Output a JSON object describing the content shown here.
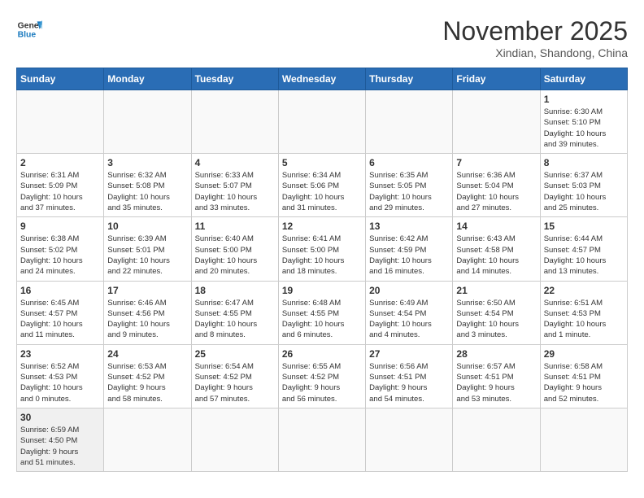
{
  "logo": {
    "text_general": "General",
    "text_blue": "Blue"
  },
  "title": "November 2025",
  "subtitle": "Xindian, Shandong, China",
  "weekdays": [
    "Sunday",
    "Monday",
    "Tuesday",
    "Wednesday",
    "Thursday",
    "Friday",
    "Saturday"
  ],
  "days": [
    {
      "date": null,
      "info": ""
    },
    {
      "date": null,
      "info": ""
    },
    {
      "date": null,
      "info": ""
    },
    {
      "date": null,
      "info": ""
    },
    {
      "date": null,
      "info": ""
    },
    {
      "date": null,
      "info": ""
    },
    {
      "date": "1",
      "info": "Sunrise: 6:30 AM\nSunset: 5:10 PM\nDaylight: 10 hours\nand 39 minutes."
    },
    {
      "date": "2",
      "info": "Sunrise: 6:31 AM\nSunset: 5:09 PM\nDaylight: 10 hours\nand 37 minutes."
    },
    {
      "date": "3",
      "info": "Sunrise: 6:32 AM\nSunset: 5:08 PM\nDaylight: 10 hours\nand 35 minutes."
    },
    {
      "date": "4",
      "info": "Sunrise: 6:33 AM\nSunset: 5:07 PM\nDaylight: 10 hours\nand 33 minutes."
    },
    {
      "date": "5",
      "info": "Sunrise: 6:34 AM\nSunset: 5:06 PM\nDaylight: 10 hours\nand 31 minutes."
    },
    {
      "date": "6",
      "info": "Sunrise: 6:35 AM\nSunset: 5:05 PM\nDaylight: 10 hours\nand 29 minutes."
    },
    {
      "date": "7",
      "info": "Sunrise: 6:36 AM\nSunset: 5:04 PM\nDaylight: 10 hours\nand 27 minutes."
    },
    {
      "date": "8",
      "info": "Sunrise: 6:37 AM\nSunset: 5:03 PM\nDaylight: 10 hours\nand 25 minutes."
    },
    {
      "date": "9",
      "info": "Sunrise: 6:38 AM\nSunset: 5:02 PM\nDaylight: 10 hours\nand 24 minutes."
    },
    {
      "date": "10",
      "info": "Sunrise: 6:39 AM\nSunset: 5:01 PM\nDaylight: 10 hours\nand 22 minutes."
    },
    {
      "date": "11",
      "info": "Sunrise: 6:40 AM\nSunset: 5:00 PM\nDaylight: 10 hours\nand 20 minutes."
    },
    {
      "date": "12",
      "info": "Sunrise: 6:41 AM\nSunset: 5:00 PM\nDaylight: 10 hours\nand 18 minutes."
    },
    {
      "date": "13",
      "info": "Sunrise: 6:42 AM\nSunset: 4:59 PM\nDaylight: 10 hours\nand 16 minutes."
    },
    {
      "date": "14",
      "info": "Sunrise: 6:43 AM\nSunset: 4:58 PM\nDaylight: 10 hours\nand 14 minutes."
    },
    {
      "date": "15",
      "info": "Sunrise: 6:44 AM\nSunset: 4:57 PM\nDaylight: 10 hours\nand 13 minutes."
    },
    {
      "date": "16",
      "info": "Sunrise: 6:45 AM\nSunset: 4:57 PM\nDaylight: 10 hours\nand 11 minutes."
    },
    {
      "date": "17",
      "info": "Sunrise: 6:46 AM\nSunset: 4:56 PM\nDaylight: 10 hours\nand 9 minutes."
    },
    {
      "date": "18",
      "info": "Sunrise: 6:47 AM\nSunset: 4:55 PM\nDaylight: 10 hours\nand 8 minutes."
    },
    {
      "date": "19",
      "info": "Sunrise: 6:48 AM\nSunset: 4:55 PM\nDaylight: 10 hours\nand 6 minutes."
    },
    {
      "date": "20",
      "info": "Sunrise: 6:49 AM\nSunset: 4:54 PM\nDaylight: 10 hours\nand 4 minutes."
    },
    {
      "date": "21",
      "info": "Sunrise: 6:50 AM\nSunset: 4:54 PM\nDaylight: 10 hours\nand 3 minutes."
    },
    {
      "date": "22",
      "info": "Sunrise: 6:51 AM\nSunset: 4:53 PM\nDaylight: 10 hours\nand 1 minute."
    },
    {
      "date": "23",
      "info": "Sunrise: 6:52 AM\nSunset: 4:53 PM\nDaylight: 10 hours\nand 0 minutes."
    },
    {
      "date": "24",
      "info": "Sunrise: 6:53 AM\nSunset: 4:52 PM\nDaylight: 9 hours\nand 58 minutes."
    },
    {
      "date": "25",
      "info": "Sunrise: 6:54 AM\nSunset: 4:52 PM\nDaylight: 9 hours\nand 57 minutes."
    },
    {
      "date": "26",
      "info": "Sunrise: 6:55 AM\nSunset: 4:52 PM\nDaylight: 9 hours\nand 56 minutes."
    },
    {
      "date": "27",
      "info": "Sunrise: 6:56 AM\nSunset: 4:51 PM\nDaylight: 9 hours\nand 54 minutes."
    },
    {
      "date": "28",
      "info": "Sunrise: 6:57 AM\nSunset: 4:51 PM\nDaylight: 9 hours\nand 53 minutes."
    },
    {
      "date": "29",
      "info": "Sunrise: 6:58 AM\nSunset: 4:51 PM\nDaylight: 9 hours\nand 52 minutes."
    },
    {
      "date": "30",
      "info": "Sunrise: 6:59 AM\nSunset: 4:50 PM\nDaylight: 9 hours\nand 51 minutes."
    },
    {
      "date": null,
      "info": ""
    },
    {
      "date": null,
      "info": ""
    },
    {
      "date": null,
      "info": ""
    },
    {
      "date": null,
      "info": ""
    },
    {
      "date": null,
      "info": ""
    },
    {
      "date": null,
      "info": ""
    }
  ]
}
